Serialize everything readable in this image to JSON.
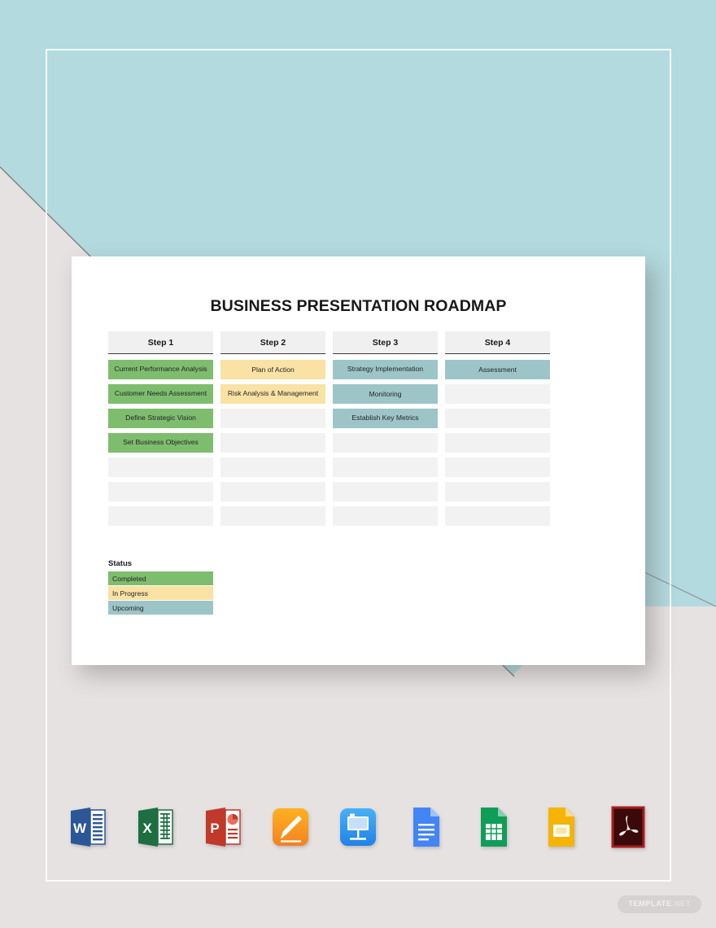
{
  "document": {
    "title": "BUSINESS PRESENTATION ROADMAP"
  },
  "roadmap": {
    "columns": [
      {
        "header": "Step 1",
        "cells": [
          {
            "label": "Current Performance Analysis",
            "status": "completed"
          },
          {
            "label": "Customer Needs Assessment",
            "status": "completed"
          },
          {
            "label": "Define Strategic Vision",
            "status": "completed"
          },
          {
            "label": "Set Business Objectives",
            "status": "completed"
          },
          {
            "label": "",
            "status": "empty"
          },
          {
            "label": "",
            "status": "empty"
          },
          {
            "label": "",
            "status": "empty"
          }
        ]
      },
      {
        "header": "Step 2",
        "cells": [
          {
            "label": "Plan of Action",
            "status": "in_progress"
          },
          {
            "label": "Risk Analysis & Management",
            "status": "in_progress"
          },
          {
            "label": "",
            "status": "empty"
          },
          {
            "label": "",
            "status": "empty"
          },
          {
            "label": "",
            "status": "empty"
          },
          {
            "label": "",
            "status": "empty"
          },
          {
            "label": "",
            "status": "empty"
          }
        ]
      },
      {
        "header": "Step 3",
        "cells": [
          {
            "label": "Strategy Implementation",
            "status": "upcoming"
          },
          {
            "label": "Monitoring",
            "status": "upcoming"
          },
          {
            "label": "Establish Key Metrics",
            "status": "upcoming"
          },
          {
            "label": "",
            "status": "empty"
          },
          {
            "label": "",
            "status": "empty"
          },
          {
            "label": "",
            "status": "empty"
          },
          {
            "label": "",
            "status": "empty"
          }
        ]
      },
      {
        "header": "Step 4",
        "cells": [
          {
            "label": "Assessment",
            "status": "upcoming"
          },
          {
            "label": "",
            "status": "empty"
          },
          {
            "label": "",
            "status": "empty"
          },
          {
            "label": "",
            "status": "empty"
          },
          {
            "label": "",
            "status": "empty"
          },
          {
            "label": "",
            "status": "empty"
          },
          {
            "label": "",
            "status": "empty"
          }
        ]
      }
    ]
  },
  "legend": {
    "title": "Status",
    "items": [
      {
        "label": "Completed",
        "status": "completed"
      },
      {
        "label": "In Progress",
        "status": "in_progress"
      },
      {
        "label": "Upcoming",
        "status": "upcoming"
      }
    ]
  },
  "colors": {
    "completed": "#7fbd6e",
    "in_progress": "#fae2a4",
    "upcoming": "#9dc5c8",
    "empty": "#f2f2f2",
    "header_bg": "#f0f0f0",
    "backdrop_teal": "#b3dade",
    "backdrop_gray": "#e6e2e2",
    "card": "#ffffff"
  },
  "app_icons": [
    {
      "name": "microsoft-word-icon",
      "label": "W"
    },
    {
      "name": "microsoft-excel-icon",
      "label": "X"
    },
    {
      "name": "microsoft-powerpoint-icon",
      "label": "P"
    },
    {
      "name": "apple-pages-icon",
      "label": ""
    },
    {
      "name": "apple-keynote-icon",
      "label": ""
    },
    {
      "name": "google-docs-icon",
      "label": ""
    },
    {
      "name": "google-sheets-icon",
      "label": ""
    },
    {
      "name": "google-slides-icon",
      "label": ""
    },
    {
      "name": "adobe-pdf-icon",
      "label": ""
    }
  ],
  "watermark": {
    "primary": "TEMPLATE",
    "secondary": ".NET"
  }
}
